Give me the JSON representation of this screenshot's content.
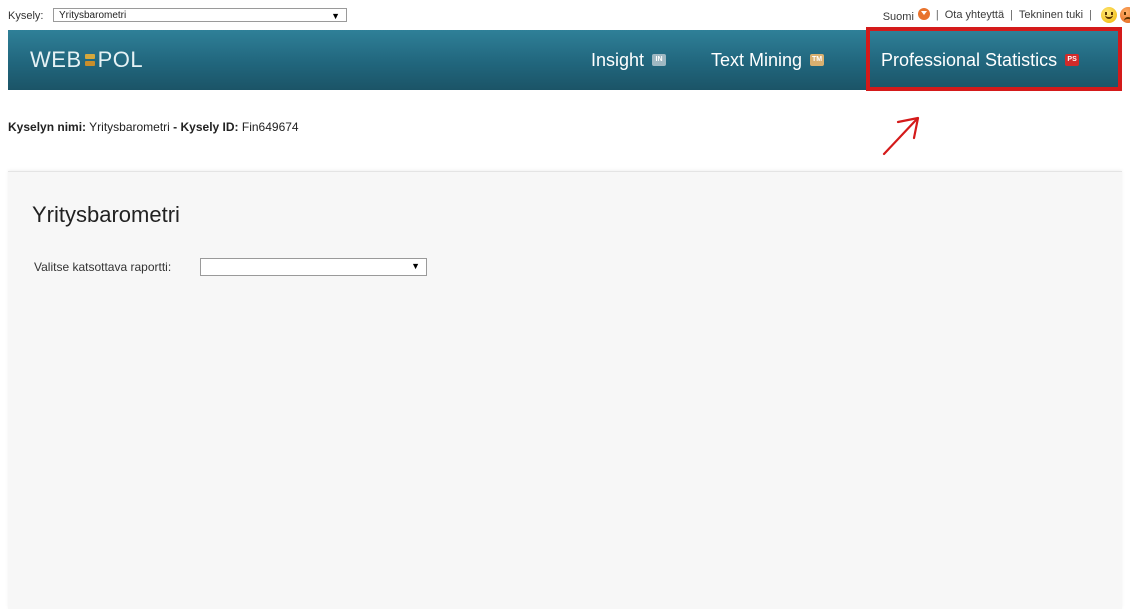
{
  "topbar": {
    "survey_label": "Kysely:",
    "survey_selected": "Yritysbarometri",
    "language": "Suomi",
    "contact_link": "Ota yhteyttä",
    "support_link": "Tekninen tuki",
    "separator": "|"
  },
  "navbar": {
    "logo_left": "WEB",
    "logo_right": "POL",
    "items": [
      {
        "label": "Insight",
        "badge": "IN",
        "badge_color": "#9fb8c2"
      },
      {
        "label": "Text Mining",
        "badge": "TM",
        "badge_color": "#d9b070"
      },
      {
        "label": "Professional Statistics",
        "badge": "PS",
        "badge_color": "#d22a2a"
      }
    ],
    "highlight_color": "#d41a1a"
  },
  "survey_info": {
    "name_label": "Kyselyn nimi:",
    "name_value": "Yritysbarometri",
    "dash": " - ",
    "id_label": "Kysely ID:",
    "id_value": "Fin649674"
  },
  "main": {
    "title": "Yritysbarometri",
    "report_label": "Valitse katsottava raportti:",
    "report_selected": ""
  },
  "icons": {
    "language": "chevron-down-circle-icon",
    "feedback_positive": "smiley-happy-icon",
    "feedback_negative": "smiley-sad-icon",
    "dropdown": "triangle-down-icon",
    "annotation": "arrow-up-right-icon"
  }
}
